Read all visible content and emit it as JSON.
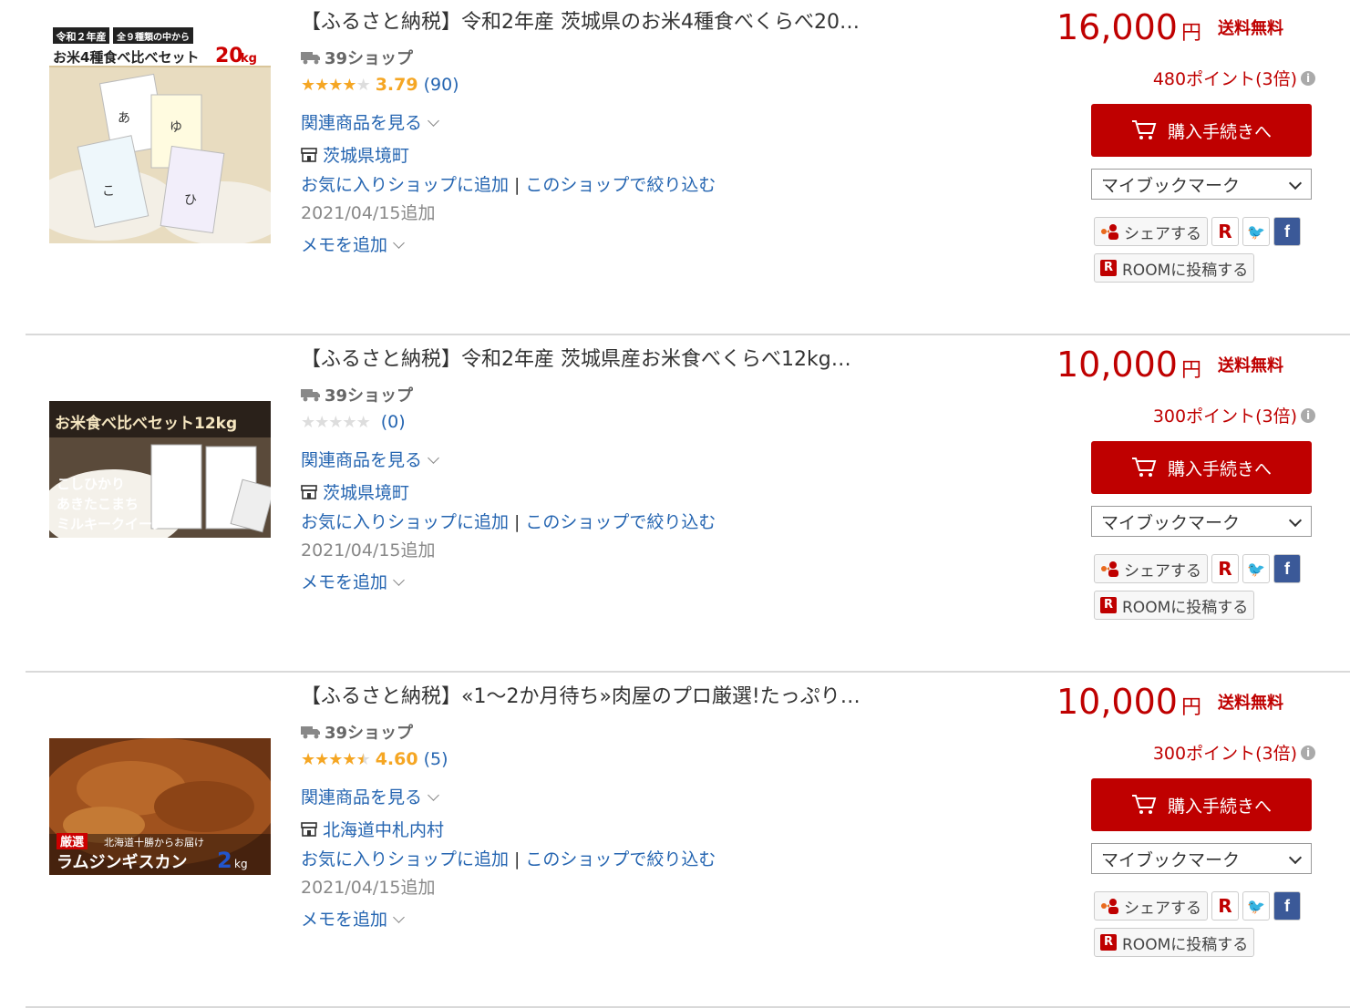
{
  "colors": {
    "accent": "#bf0000",
    "link": "#2565b1",
    "star": "#f5a623"
  },
  "items": [
    {
      "title": "【ふるさと納税】令和2年産 茨城県のお米4種食べくらべ20…",
      "shop": "39ショップ",
      "stars": 3.79,
      "rating_score": "3.79",
      "rating_count": "(90)",
      "related": "関連商品を見る",
      "locale": "茨城県境町",
      "fav_link": "お気に入りショップに追加",
      "sep": "|",
      "filter_link": "このショップで絞り込む",
      "added": "2021/04/15追加",
      "memo": "メモを追加",
      "price": "16,000",
      "yen": "円",
      "shipping": "送料無料",
      "points": "480ポイント(3倍)",
      "buy_label": "購入手続きへ",
      "bookmark": "マイブックマーク",
      "share": "シェアする",
      "room": "ROOMに投稿する",
      "thumb": {
        "line1": "令和２年産",
        "line2": "全９種類の中から",
        "line3": "お米4種食べ比べセット",
        "kg": "20",
        "unit": "kg"
      }
    },
    {
      "title": "【ふるさと納税】令和2年産 茨城県産お米食べくらべ12kg…",
      "shop": "39ショップ",
      "stars": 0,
      "rating_score": "",
      "rating_count": "(0)",
      "related": "関連商品を見る",
      "locale": "茨城県境町",
      "fav_link": "お気に入りショップに追加",
      "sep": "|",
      "filter_link": "このショップで絞り込む",
      "added": "2021/04/15追加",
      "memo": "メモを追加",
      "price": "10,000",
      "yen": "円",
      "shipping": "送料無料",
      "points": "300ポイント(3倍)",
      "buy_label": "購入手続きへ",
      "bookmark": "マイブックマーク",
      "share": "シェアする",
      "room": "ROOMに投稿する",
      "thumb": {
        "line1": "お米食べ比べセット12kg",
        "line2": "こしひかり",
        "line3": "あきたこまち",
        "line4": "ミルキークイーン"
      }
    },
    {
      "title": "【ふるさと納税】«1～2か月待ち»肉屋のプロ厳選!たっぷり…",
      "shop": "39ショップ",
      "stars": 4.6,
      "rating_score": "4.60",
      "rating_count": "(5)",
      "related": "関連商品を見る",
      "locale": "北海道中札内村",
      "fav_link": "お気に入りショップに追加",
      "sep": "|",
      "filter_link": "このショップで絞り込む",
      "added": "2021/04/15追加",
      "memo": "メモを追加",
      "price": "10,000",
      "yen": "円",
      "shipping": "送料無料",
      "points": "300ポイント(3倍)",
      "buy_label": "購入手続きへ",
      "bookmark": "マイブックマーク",
      "share": "シェアする",
      "room": "ROOMに投稿する",
      "thumb": {
        "line1": "厳選",
        "line2": "北海道十勝からお届け",
        "line3": "ラムジンギスカン",
        "kg": "2",
        "unit": "kg"
      }
    }
  ]
}
